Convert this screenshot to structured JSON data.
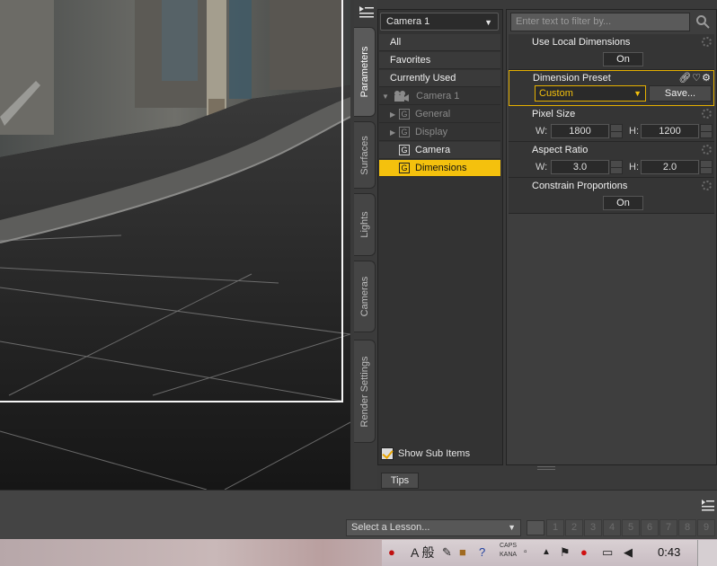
{
  "viewport": {},
  "side_tabs": [
    "Parameters",
    "Surfaces",
    "Lights",
    "Cameras",
    "Render Settings"
  ],
  "tree": {
    "camera_select": "Camera 1",
    "items": [
      {
        "label": "All"
      },
      {
        "label": "Favorites"
      },
      {
        "label": "Currently Used"
      },
      {
        "label": "Camera 1"
      },
      {
        "label": "General"
      },
      {
        "label": "Display"
      },
      {
        "label": "Camera"
      },
      {
        "label": "Dimensions"
      }
    ],
    "show_sub_items": "Show Sub Items",
    "show_sub_items_checked": true
  },
  "properties": {
    "filter_placeholder": "Enter text to filter by...",
    "use_local_dimensions": {
      "label": "Use Local Dimensions",
      "value": "On"
    },
    "dimension_preset": {
      "label": "Dimension Preset",
      "value": "Custom",
      "save": "Save..."
    },
    "pixel_size": {
      "label": "Pixel Size",
      "w_label": "W:",
      "w": "1800",
      "h_label": "H:",
      "h": "1200"
    },
    "aspect_ratio": {
      "label": "Aspect Ratio",
      "w_label": "W:",
      "w": "3.0",
      "h_label": "H:",
      "h": "2.0"
    },
    "constrain_proportions": {
      "label": "Constrain Proportions",
      "value": "On"
    }
  },
  "tips": {
    "label": "Tips"
  },
  "lessons": {
    "select": "Select a Lesson...",
    "numbers": [
      "1",
      "2",
      "3",
      "4",
      "5",
      "6",
      "7",
      "8",
      "9"
    ]
  },
  "taskbar": {
    "ime": "A 般",
    "caps": "CAPS",
    "kana": "KANA",
    "clock": "0:43"
  },
  "colors": {
    "accent": "#f4c10d",
    "panel": "#3e3e3e",
    "viewport": "#1a1a1a"
  }
}
